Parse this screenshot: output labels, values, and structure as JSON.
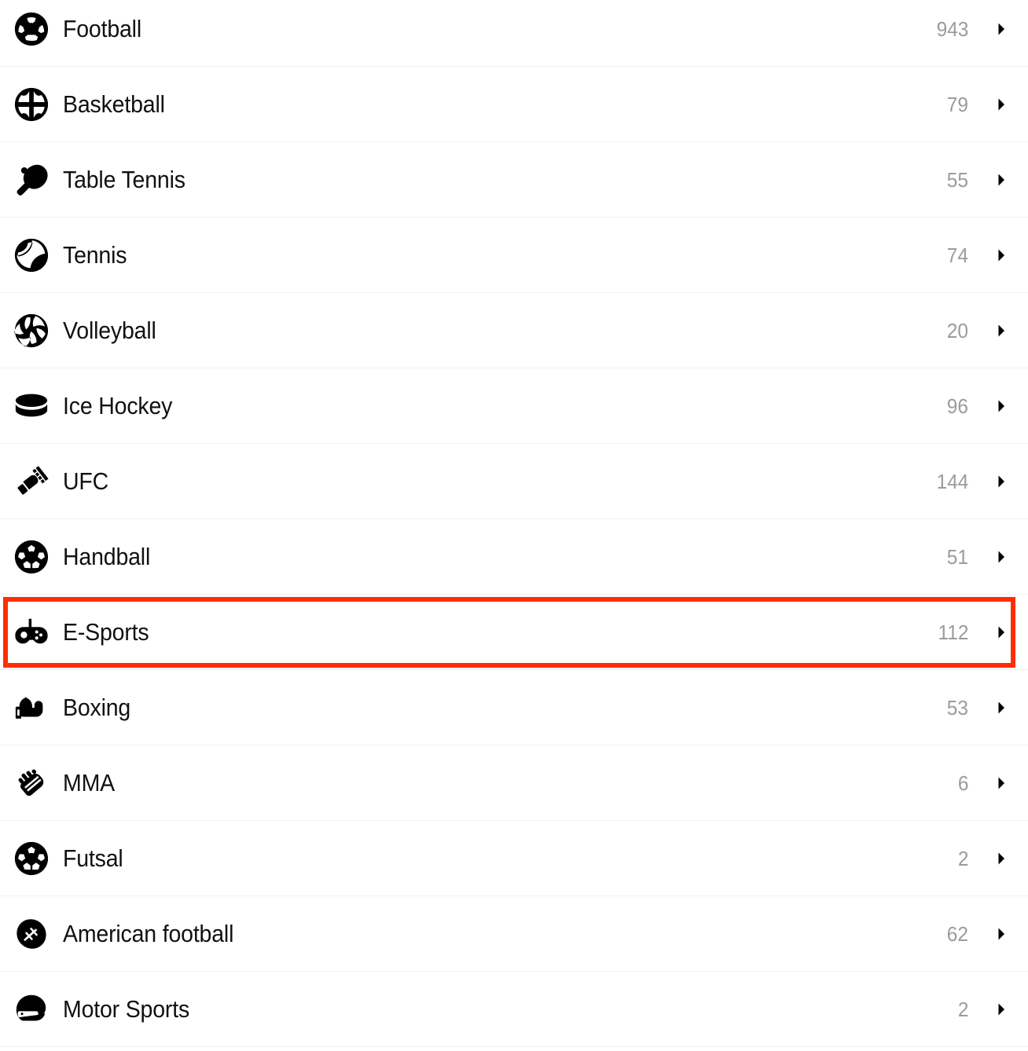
{
  "list": {
    "name": "sports-category-list",
    "highlighted_item": "E-Sports",
    "highlight_color": "#ff2d00",
    "count_color": "#9b9b9b",
    "label_color": "#111111",
    "divider_color": "#f1f1f1",
    "chevron_glyph": "chevron-right-icon",
    "items": [
      {
        "label": "Football",
        "count": "943",
        "icon": "football-icon"
      },
      {
        "label": "Basketball",
        "count": "79",
        "icon": "basketball-icon"
      },
      {
        "label": "Table Tennis",
        "count": "55",
        "icon": "table-tennis-paddle-icon"
      },
      {
        "label": "Tennis",
        "count": "74",
        "icon": "tennis-ball-icon"
      },
      {
        "label": "Volleyball",
        "count": "20",
        "icon": "volleyball-icon"
      },
      {
        "label": "Ice Hockey",
        "count": "96",
        "icon": "hockey-puck-icon"
      },
      {
        "label": "UFC",
        "count": "144",
        "icon": "ufc-gloves-icon"
      },
      {
        "label": "Handball",
        "count": "51",
        "icon": "handball-icon"
      },
      {
        "label": "E-Sports",
        "count": "112",
        "icon": "gamepad-icon"
      },
      {
        "label": "Boxing",
        "count": "53",
        "icon": "boxing-glove-icon"
      },
      {
        "label": "MMA",
        "count": "6",
        "icon": "mma-fist-icon"
      },
      {
        "label": "Futsal",
        "count": "2",
        "icon": "futsal-ball-icon"
      },
      {
        "label": "American football",
        "count": "62",
        "icon": "american-football-icon"
      },
      {
        "label": "Motor Sports",
        "count": "2",
        "icon": "racing-helmet-icon"
      }
    ]
  }
}
